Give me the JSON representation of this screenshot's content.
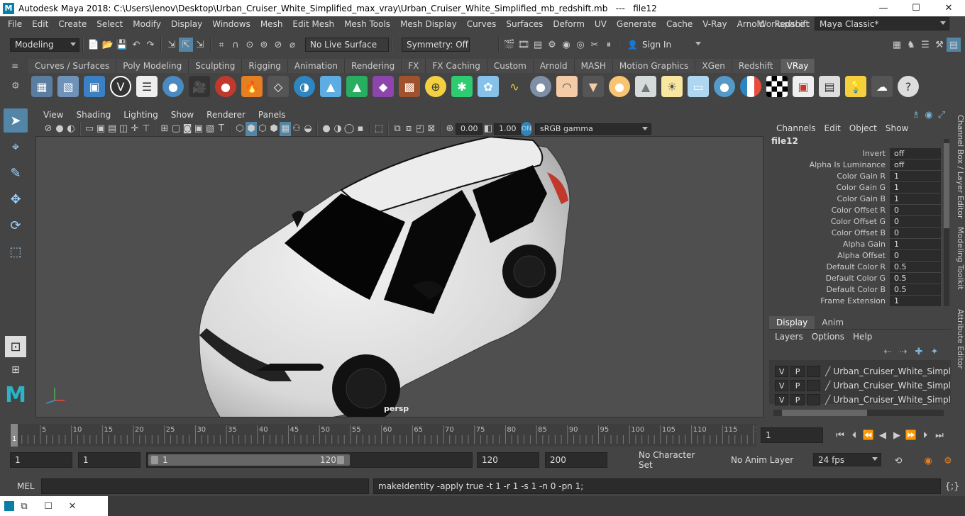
{
  "title": "Autodesk Maya 2018: C:\\Users\\lenov\\Desktop\\Urban_Cruiser_White_Simplified_max_vray\\Urban_Cruiser_White_Simplified_mb_redshift.mb   ---   file12",
  "logo": "M",
  "window_controls": {
    "minimize": "—",
    "maximize": "☐",
    "close": "✕"
  },
  "menu": [
    "File",
    "Edit",
    "Create",
    "Select",
    "Modify",
    "Display",
    "Windows",
    "Mesh",
    "Edit Mesh",
    "Mesh Tools",
    "Mesh Display",
    "Curves",
    "Surfaces",
    "Deform",
    "UV",
    "Generate",
    "Cache",
    "V-Ray",
    "Arnold",
    "Redshift"
  ],
  "workspace": {
    "label": "Workspace :",
    "value": "Maya Classic*"
  },
  "status": {
    "mode": "Modeling",
    "live_surface": "No Live Surface",
    "symmetry": "Symmetry: Off",
    "sign_in": "Sign In"
  },
  "shelf_tabs": [
    "Curves / Surfaces",
    "Poly Modeling",
    "Sculpting",
    "Rigging",
    "Animation",
    "Rendering",
    "FX",
    "FX Caching",
    "Custom",
    "Arnold",
    "MASH",
    "Motion Graphics",
    "XGen",
    "Redshift",
    "VRay"
  ],
  "shelf_active": "VRay",
  "viewport": {
    "menu": [
      "View",
      "Shading",
      "Lighting",
      "Show",
      "Renderer",
      "Panels"
    ],
    "exposure": "0.00",
    "gamma": "1.00",
    "color_space": "sRGB gamma",
    "camera": "persp"
  },
  "channel_box": {
    "menu": [
      "Channels",
      "Edit",
      "Object",
      "Show"
    ],
    "node": "file12",
    "attrs": [
      {
        "label": "Invert",
        "value": "off"
      },
      {
        "label": "Alpha Is Luminance",
        "value": "off"
      },
      {
        "label": "Color Gain R",
        "value": "1"
      },
      {
        "label": "Color Gain G",
        "value": "1"
      },
      {
        "label": "Color Gain B",
        "value": "1"
      },
      {
        "label": "Color Offset R",
        "value": "0"
      },
      {
        "label": "Color Offset G",
        "value": "0"
      },
      {
        "label": "Color Offset B",
        "value": "0"
      },
      {
        "label": "Alpha Gain",
        "value": "1"
      },
      {
        "label": "Alpha Offset",
        "value": "0"
      },
      {
        "label": "Default Color R",
        "value": "0.5"
      },
      {
        "label": "Default Color G",
        "value": "0.5"
      },
      {
        "label": "Default Color B",
        "value": "0.5"
      },
      {
        "label": "Frame Extension",
        "value": "1"
      }
    ]
  },
  "layer_editor": {
    "tabs": [
      "Display",
      "Anim"
    ],
    "menu": [
      "Layers",
      "Options",
      "Help"
    ],
    "v": "V",
    "p": "P",
    "layers": [
      "Urban_Cruiser_White_Simpl",
      "Urban_Cruiser_White_Simpl",
      "Urban_Cruiser_White_Simpl"
    ]
  },
  "side_tabs": [
    "Channel Box / Layer Editor",
    "Modeling Toolkit",
    "Attribute Editor"
  ],
  "timeline": {
    "ticks": [
      "5",
      "10",
      "15",
      "20",
      "25",
      "30",
      "35",
      "40",
      "45",
      "50",
      "55",
      "60",
      "65",
      "70",
      "75",
      "80",
      "85",
      "90",
      "95",
      "100",
      "105",
      "110",
      "115",
      "12"
    ],
    "current_marker": "1",
    "current_frame": "1"
  },
  "range": {
    "start": "1",
    "playback_start": "1",
    "slider_start": "1",
    "slider_end": "120",
    "playback_end": "120",
    "end": "200",
    "character_set": "No Character Set",
    "anim_layer": "No Anim Layer",
    "fps": "24 fps"
  },
  "command": {
    "lang": "MEL",
    "result": "makeIdentity -apply true -t 1 -r 1 -s 1 -n 0 -pn 1;"
  }
}
